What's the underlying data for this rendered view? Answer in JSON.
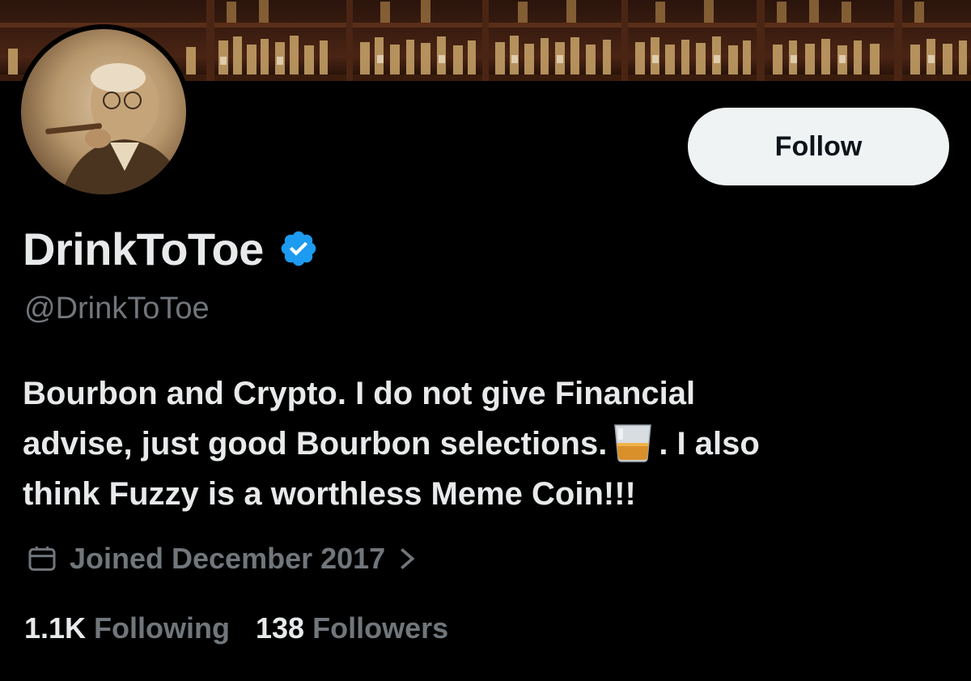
{
  "profile": {
    "display_name": "DrinkToToe",
    "handle": "@DrinkToToe",
    "verified": true,
    "bio_line1": "Bourbon and Crypto. I do not give Financial",
    "bio_line2a": "advise, just good Bourbon selections.",
    "bio_line2b": ". I also",
    "bio_line3": "think Fuzzy is a worthless Meme Coin!!!",
    "bio_emoji": "tumbler-glass-icon",
    "joined": "Joined December 2017"
  },
  "actions": {
    "follow_label": "Follow"
  },
  "stats": {
    "following_count": "1.1K",
    "following_label": "Following",
    "followers_count": "138",
    "followers_label": "Followers"
  },
  "icons": {
    "verified": "verified-badge-icon",
    "calendar": "calendar-icon",
    "chevron": "chevron-right-icon"
  },
  "colors": {
    "background": "#000000",
    "primary_text": "#e7e9ea",
    "secondary_text": "#71767b",
    "verified_blue": "#1d9bf0",
    "button_bg": "#eff3f4"
  }
}
